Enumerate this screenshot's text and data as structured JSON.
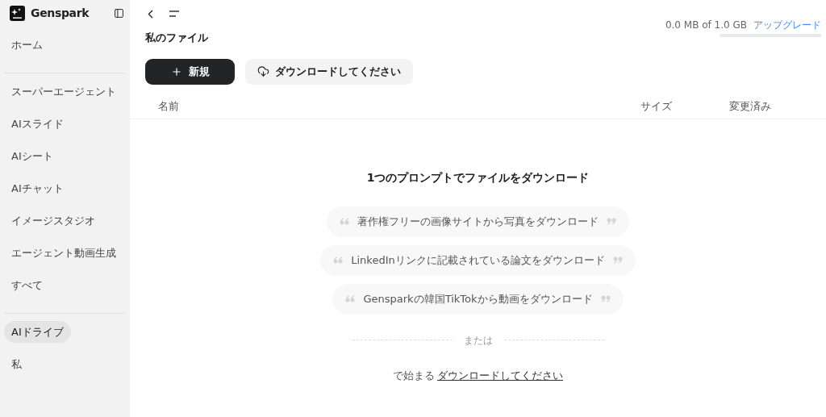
{
  "sidebar": {
    "brand": "Genspark",
    "sections": [
      [
        {
          "label": "ホーム",
          "selected": false
        }
      ],
      [
        {
          "label": "スーパーエージェント",
          "selected": false
        },
        {
          "label": "AIスライド",
          "selected": false
        },
        {
          "label": "AIシート",
          "selected": false
        },
        {
          "label": "AIチャット",
          "selected": false
        },
        {
          "label": "イメージスタジオ",
          "selected": false
        },
        {
          "label": "エージェント動画生成",
          "selected": false
        },
        {
          "label": "すべて",
          "selected": false
        }
      ],
      [
        {
          "label": "AIドライブ",
          "selected": true
        },
        {
          "label": "私",
          "selected": false
        }
      ]
    ]
  },
  "storage": {
    "text": "0.0 MB of 1.0 GB",
    "level": 0.0,
    "upgrade": "アップグレード"
  },
  "title": "私のファイル",
  "buttons": [
    {
      "kind": "primary",
      "label": "新規"
    },
    {
      "kind": "secondary",
      "label": "ダウンロードしてください"
    }
  ],
  "table": {
    "columns": [
      "名前",
      "サイズ",
      "変更済み"
    ]
  },
  "empty": {
    "heading": "1つのプロンプトでファイルをダウンロード",
    "prompts": [
      "著作権フリーの画像サイトから写真をダウンロード",
      "LinkedInリンクに記載されている論文をダウンロード",
      "Gensparkの韓国TikTokから動画をダウンロード"
    ],
    "divider": "または",
    "footer_prefix": "で始まる",
    "footer_link": "ダウンロードしてください"
  }
}
